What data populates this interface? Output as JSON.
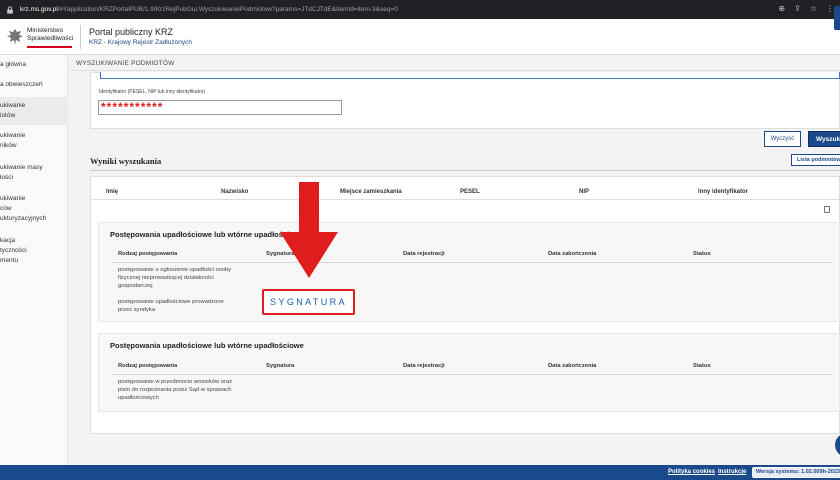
{
  "browser": {
    "url_host": "krz.ms.gov.pl",
    "url_path": "/#!/application/KRZPortalPUB/1.9/KrzRejPubGui.WyszukiwaniePodmiotow?params=JTdCJTdE&itemId=item-3&seq=0"
  },
  "header": {
    "ministry_line1": "Ministerstwo",
    "ministry_line2": "Sprawiedliwości",
    "portal_title": "Portal publiczny KRZ",
    "portal_subtitle": "KRZ - Krajowy Rejestr Zadłużonych"
  },
  "sidebar": {
    "items": [
      {
        "label": "a główna"
      },
      {
        "label": "a obwieszczeń"
      },
      {
        "label": "ukiwanie\niotów"
      },
      {
        "label": "ukiwanie\nników"
      },
      {
        "label": "ukiwanie masy\nłości"
      },
      {
        "label": "ukiwanie\nców\nukturyzacyjnych"
      },
      {
        "label": "kacja\ntyczności\nmentu"
      }
    ]
  },
  "main": {
    "section_label": "WYSZUKIWANIE PODMIOTÓW",
    "id_field_label": "Identyfikator (PESEL, NIP lub inny identyfikator)",
    "id_field_value": "***********",
    "clear_button": "Wyczyść",
    "search_button": "Wyszuk",
    "results_title": "Wyniki wyszukania",
    "list_button": "Lista podmiotów",
    "columns": [
      "Imię",
      "Nazwisko",
      "Miejsce zamieszkania",
      "PESEL",
      "NIP",
      "Inny identyfikator"
    ],
    "groups": [
      {
        "title": "Postępowania upadłościowe lub wtórne upadłościowe",
        "headers": [
          "Rodzaj postępowania",
          "Sygnatura",
          "Data rejestracji",
          "Data zakończenia",
          "Status"
        ],
        "rows": [
          {
            "type": "postępowanie o ogłoszenie upadłości osoby\nfizycznej nieprowadzącej działalności\ngospodarczej"
          },
          {
            "type": "postępowanie upadłościowe prowadzone\nprzez syndyka"
          }
        ]
      },
      {
        "title": "Postępowania upadłościowe lub wtórne upadłościowe",
        "headers": [
          "Rodzaj postępowania",
          "Sygnatura",
          "Data rejestracji",
          "Data zakończenia",
          "Status"
        ],
        "rows": [
          {
            "type": "postępowanie w przedmiocie wniosków oraz\npism do rozpoznania przez Sąd w sprawach\nupadłościowych"
          }
        ]
      }
    ],
    "annotation_label": "SYGNATURA"
  },
  "footer": {
    "cookies": "Polityka cookies",
    "instructions": "Instrukcje",
    "version": "Wersja systemu: 1.02.009h-2023"
  },
  "colors": {
    "brand_blue": "#1b4a8c",
    "highlight_red": "#e01d1d"
  }
}
